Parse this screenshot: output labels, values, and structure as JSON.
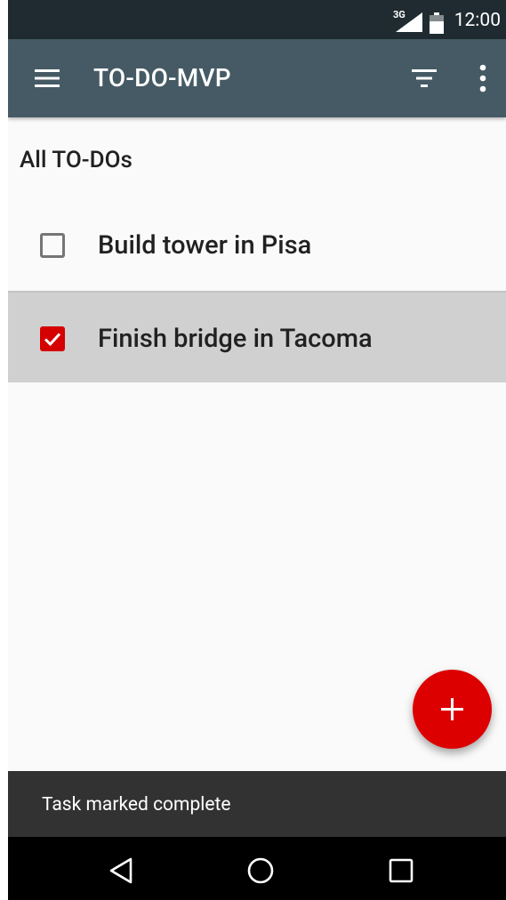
{
  "status_bar": {
    "network": "3G",
    "time": "12:00",
    "icons": [
      "signal-icon",
      "battery-icon"
    ]
  },
  "app_bar": {
    "title": "TO-DO-MVP",
    "icons": [
      "menu-icon",
      "filter-icon",
      "more-vert-icon"
    ],
    "color": "#455a64"
  },
  "content": {
    "section_title": "All TO-DOs",
    "tasks": [
      {
        "title": "Build tower in Pisa",
        "completed": false
      },
      {
        "title": "Finish bridge in Tacoma",
        "completed": true
      }
    ]
  },
  "fab": {
    "icon": "add-icon",
    "color": "#dd0000"
  },
  "snackbar": {
    "message": "Task marked complete"
  },
  "nav_bar": {
    "icons": [
      "back-icon",
      "home-icon",
      "recents-icon"
    ]
  }
}
